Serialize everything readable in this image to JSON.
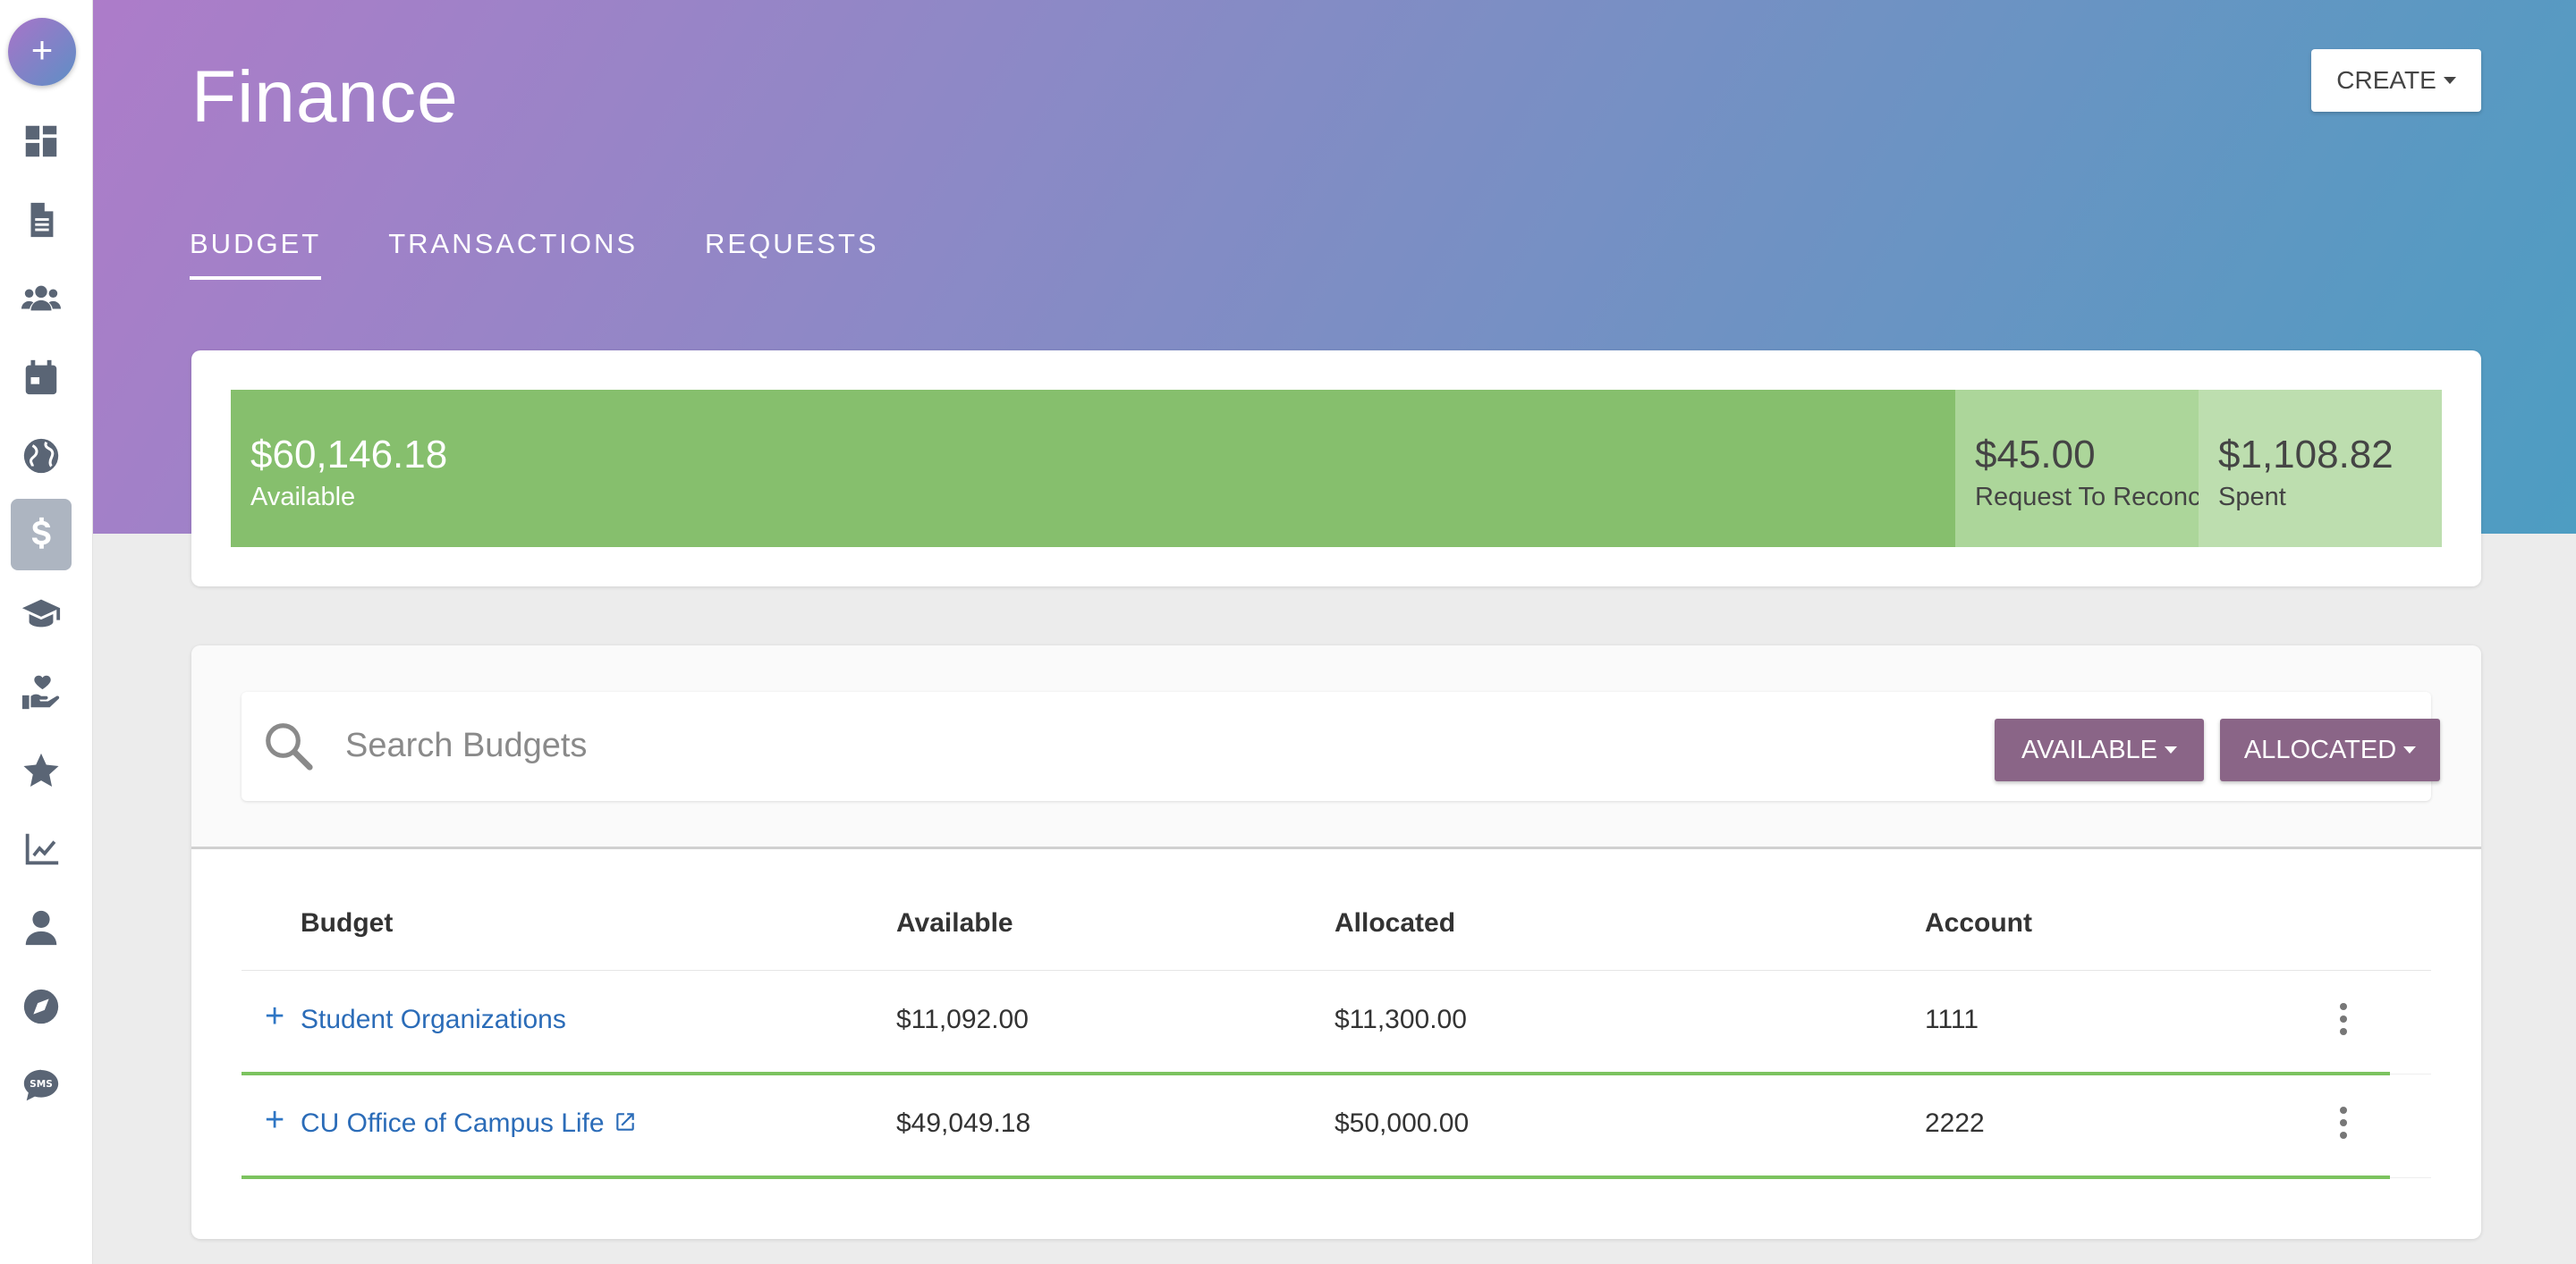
{
  "app": {
    "title": "Finance",
    "create_label": "CREATE"
  },
  "sidebar": {
    "fab_label": "+",
    "items": [
      {
        "icon": "dashboard-icon"
      },
      {
        "icon": "document-icon"
      },
      {
        "icon": "users-icon"
      },
      {
        "icon": "calendar-icon"
      },
      {
        "icon": "globe-icon"
      },
      {
        "icon": "dollar-icon",
        "active": true
      },
      {
        "icon": "graduation-cap-icon"
      },
      {
        "icon": "hand-heart-icon"
      },
      {
        "icon": "star-icon"
      },
      {
        "icon": "chart-line-icon"
      },
      {
        "icon": "user-icon"
      },
      {
        "icon": "compass-icon"
      },
      {
        "icon": "sms-icon"
      }
    ]
  },
  "tabs": [
    {
      "label": "BUDGET",
      "active": true
    },
    {
      "label": "TRANSACTIONS"
    },
    {
      "label": "REQUESTS"
    }
  ],
  "summary": {
    "available": {
      "amount": "$60,146.18",
      "label": "Available",
      "color": "#86bf6d"
    },
    "request": {
      "amount": "$45.00",
      "label": "Request To Reconcile",
      "color": "#acd69a"
    },
    "spent": {
      "amount": "$1,108.82",
      "label": "Spent",
      "color": "#bddeaf"
    }
  },
  "search": {
    "placeholder": "Search Budgets",
    "filter_available": "AVAILABLE",
    "filter_allocated": "ALLOCATED"
  },
  "table": {
    "headers": {
      "budget": "Budget",
      "available": "Available",
      "allocated": "Allocated",
      "account": "Account"
    },
    "rows": [
      {
        "expand": "+",
        "budget": "Student Organizations",
        "available": "$11,092.00",
        "allocated": "$11,300.00",
        "account": "1111"
      },
      {
        "expand": "+",
        "budget": "CU Office of Campus Life",
        "available": "$49,049.18",
        "allocated": "$50,000.00",
        "account": "2222"
      }
    ]
  }
}
